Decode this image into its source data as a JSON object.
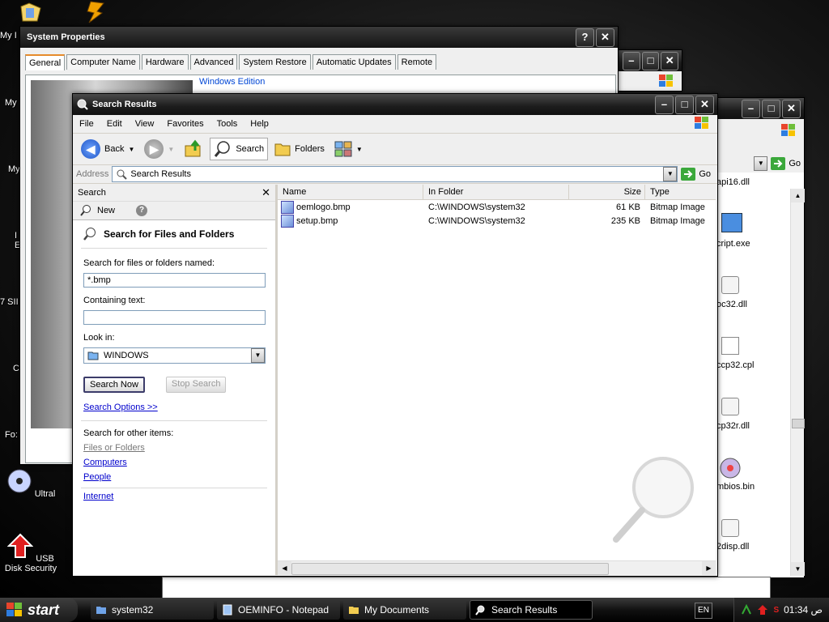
{
  "desktop": {
    "icons": [
      {
        "label": "USB Disk Security"
      },
      {
        "label": "Ultral"
      }
    ],
    "edge_labels": [
      "My I",
      "My",
      "My",
      "I",
      "E",
      "7 SII",
      "C",
      "Fo:"
    ]
  },
  "system_properties": {
    "title": "System Properties",
    "help_label": "?",
    "close_label": "✕",
    "tabs": [
      "General",
      "Computer Name",
      "Hardware",
      "Advanced",
      "System Restore",
      "Automatic Updates",
      "Remote"
    ],
    "section_label": "Windows Edition"
  },
  "bg_explorer": {
    "files": [
      "api16.dll",
      "cript.exe",
      "oc32.dll",
      "ccp32.cpl",
      "cp32r.dll",
      "mbios.bin",
      "2disp.dll"
    ],
    "go_label": "Go"
  },
  "search_window": {
    "title": "Search Results",
    "menu": [
      "File",
      "Edit",
      "View",
      "Favorites",
      "Tools",
      "Help"
    ],
    "toolbar": {
      "back": "Back",
      "search": "Search",
      "folders": "Folders"
    },
    "address": {
      "label": "Address",
      "value": "Search Results",
      "go": "Go"
    },
    "search_pane": {
      "title": "Search",
      "new_label": "New",
      "heading": "Search for Files and Folders",
      "named_label": "Search for files or folders named:",
      "named_value": "*.bmp",
      "containing_label": "Containing text:",
      "containing_value": "",
      "lookin_label": "Look in:",
      "lookin_value": "WINDOWS",
      "search_now": "Search Now",
      "stop_search": "Stop Search",
      "options": "Search Options >>",
      "other_label": "Search for other items:",
      "other_links": [
        "Files or Folders",
        "Computers",
        "People"
      ],
      "internet": "Internet"
    },
    "columns": [
      "Name",
      "In Folder",
      "Size",
      "Type"
    ],
    "results": [
      {
        "name": "oemlogo.bmp",
        "folder": "C:\\WINDOWS\\system32",
        "size": "61 KB",
        "type": "Bitmap Image"
      },
      {
        "name": "setup.bmp",
        "folder": "C:\\WINDOWS\\system32",
        "size": "235 KB",
        "type": "Bitmap Image"
      }
    ]
  },
  "taskbar": {
    "start": "start",
    "tasks": [
      "system32",
      "OEMINFO - Notepad",
      "My Documents",
      "Search Results"
    ],
    "language": "EN",
    "time": "01:34 ص"
  }
}
